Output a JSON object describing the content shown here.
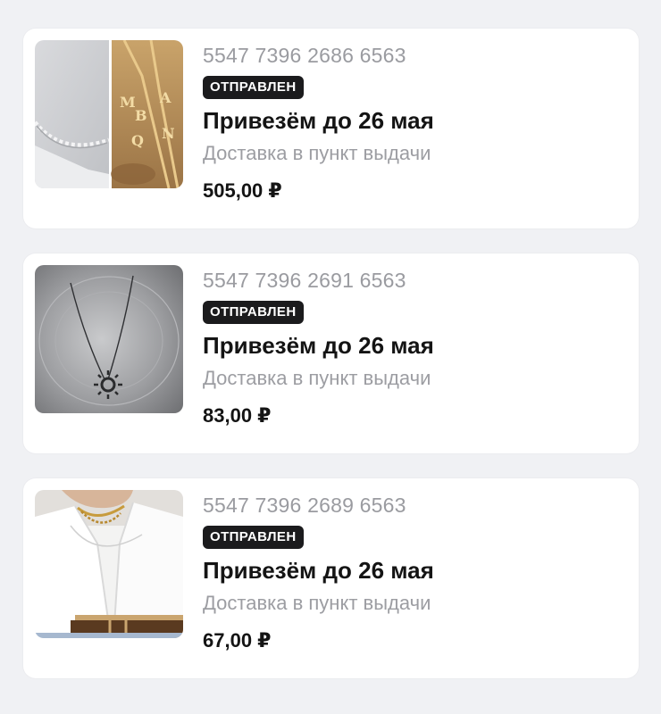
{
  "orders": [
    {
      "number": "5547 7396 2686 6563",
      "status": "ОТПРАВЛЕН",
      "delivery_date": "Привезём до 26 мая",
      "delivery_method": "Доставка в пункт выдачи",
      "price": "505,00 ₽",
      "thumbnail_icon": "necklace-letters-photo"
    },
    {
      "number": "5547 7396 2691 6563",
      "status": "ОТПРАВЛЕН",
      "delivery_date": "Привезём до 26 мая",
      "delivery_method": "Доставка в пункт выдачи",
      "price": "83,00 ₽",
      "thumbnail_icon": "sun-pendant-photo"
    },
    {
      "number": "5547 7396 2689 6563",
      "status": "ОТПРАВЛЕН",
      "delivery_date": "Привезём до 26 мая",
      "delivery_method": "Доставка в пункт выдачи",
      "price": "67,00 ₽",
      "thumbnail_icon": "white-shirt-chain-photo"
    }
  ],
  "colors": {
    "background": "#f0f1f4",
    "card": "#ffffff",
    "badge_bg": "#1b1b1d",
    "badge_text": "#ffffff",
    "muted_text": "#9a9ba0",
    "primary_text": "#141414"
  }
}
